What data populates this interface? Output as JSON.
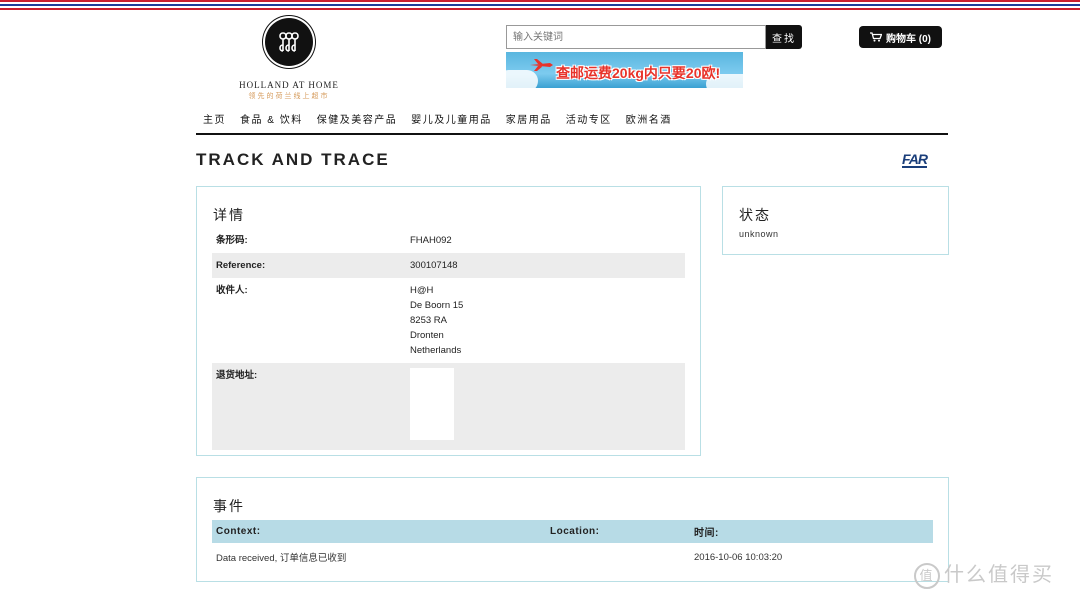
{
  "colors": {
    "stripe_red": "#c81e2d",
    "stripe_blue": "#1d3e9a",
    "panel_border": "#b9dfe5",
    "table_header": "#b7dbe6",
    "shade": "#ececec",
    "logo_sub": "#d59a5a"
  },
  "header": {
    "logo_name": "HOLLAND AT HOME",
    "logo_sub": "领先的荷兰线上超市",
    "search_placeholder": "输入关键词",
    "search_button": "查找",
    "banner_text": "查邮运费20kg内只要20欧!",
    "cart_label": "购物车 (0)"
  },
  "nav": [
    "主页",
    "食品 & 饮料",
    "保健及美容产品",
    "婴儿及儿童用品",
    "家居用品",
    "活动专区",
    "欧洲名酒"
  ],
  "page": {
    "title": "TRACK AND TRACE",
    "carrier_logo": "FAR"
  },
  "detail": {
    "heading": "详情",
    "barcode_label": "条形码:",
    "barcode_value": "FHAH092",
    "reference_label": "Reference:",
    "reference_value": "300107148",
    "recipient_label": "收件人:",
    "recipient_lines": [
      "H@H",
      "De Boorn 15",
      "8253 RA",
      "Dronten",
      "Netherlands"
    ],
    "return_label": "退货地址:"
  },
  "status": {
    "heading": "状态",
    "value": "unknown"
  },
  "events": {
    "heading": "事件",
    "columns": [
      "Context:",
      "Location:",
      "时间:"
    ],
    "rows": [
      {
        "context": "Data received, 订单信息已收到",
        "location": "",
        "time": "2016-10-06 10:03:20"
      }
    ]
  },
  "watermark": {
    "badge": "值",
    "text": "什么值得买"
  }
}
